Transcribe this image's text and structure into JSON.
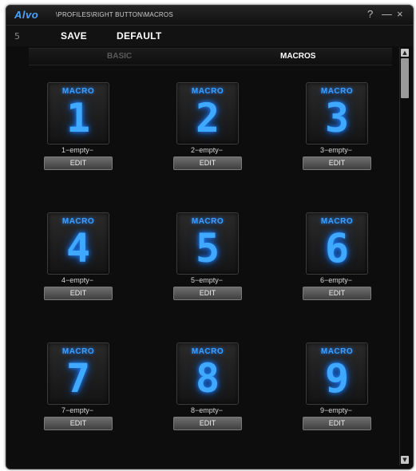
{
  "window": {
    "logo": "Alvo",
    "breadcrumb": "\\PROFILES\\RIGHT BUTTON\\MACROS",
    "help": "?",
    "minimize": "—",
    "close": "×"
  },
  "toolbar": {
    "back": "5",
    "save_label": "SAVE",
    "default_label": "DEFAULT"
  },
  "tabs": [
    {
      "label": "BASIC",
      "active": false
    },
    {
      "label": "MACROS",
      "active": true
    }
  ],
  "scrollbar": {
    "up": "▲",
    "down": "▼"
  },
  "macros": [
    {
      "tile_label": "MACRO",
      "number": "1",
      "slot": "1−empty−",
      "edit": "EDIT"
    },
    {
      "tile_label": "MACRO",
      "number": "2",
      "slot": "2−empty−",
      "edit": "EDIT"
    },
    {
      "tile_label": "MACRO",
      "number": "3",
      "slot": "3−empty−",
      "edit": "EDIT"
    },
    {
      "tile_label": "MACRO",
      "number": "4",
      "slot": "4−empty−",
      "edit": "EDIT"
    },
    {
      "tile_label": "MACRO",
      "number": "5",
      "slot": "5−empty−",
      "edit": "EDIT"
    },
    {
      "tile_label": "MACRO",
      "number": "6",
      "slot": "6−empty−",
      "edit": "EDIT"
    },
    {
      "tile_label": "MACRO",
      "number": "7",
      "slot": "7−empty−",
      "edit": "EDIT"
    },
    {
      "tile_label": "MACRO",
      "number": "8",
      "slot": "8−empty−",
      "edit": "EDIT"
    },
    {
      "tile_label": "MACRO",
      "number": "9",
      "slot": "9−empty−",
      "edit": "EDIT"
    }
  ],
  "colors": {
    "accent": "#3fa9ff",
    "background": "#0d0d0d"
  }
}
